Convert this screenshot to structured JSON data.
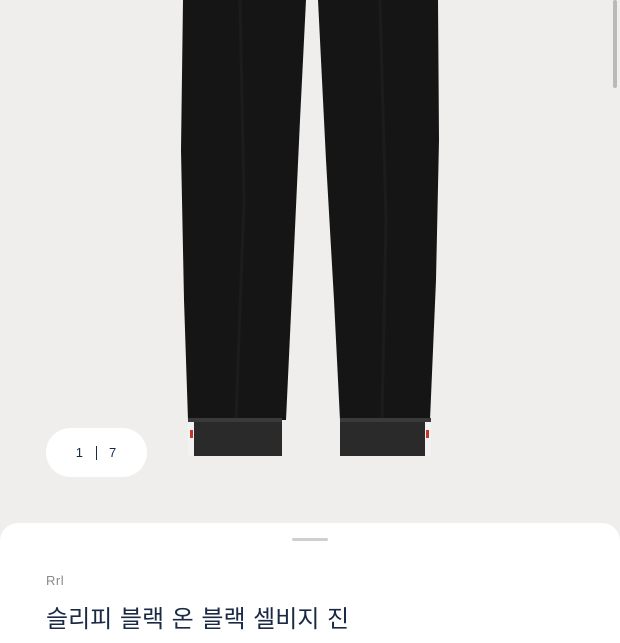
{
  "gallery": {
    "current": "1",
    "total": "7",
    "image_alt": "black jeans product photo"
  },
  "product": {
    "brand": "Rrl",
    "title": "슬리피 블랙 온 블랙 셀비지 진"
  },
  "colors": {
    "background": "#efeeed",
    "denim": "#141414",
    "accent_text": "#1a2a44"
  }
}
